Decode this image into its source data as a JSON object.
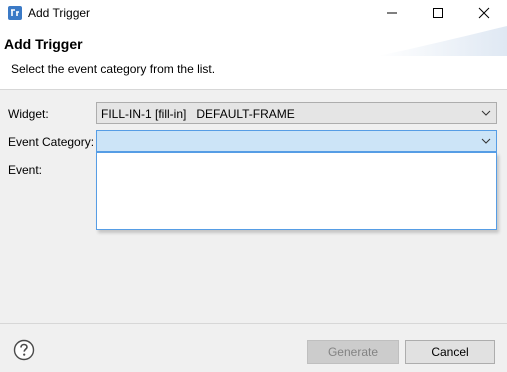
{
  "window": {
    "title": "Add Trigger"
  },
  "header": {
    "title": "Add Trigger",
    "message": "Select the event category from the list."
  },
  "form": {
    "widget": {
      "label": "Widget:",
      "value": "FILL-IN-1 [fill-in]   DEFAULT-FRAME"
    },
    "event_category": {
      "label": "Event Category:",
      "value": ""
    },
    "event": {
      "label": "Event:"
    }
  },
  "footer": {
    "generate_label": "Generate",
    "cancel_label": "Cancel"
  },
  "icons": {
    "app": "app-icon",
    "minimize": "minimize-icon",
    "maximize": "maximize-icon",
    "close": "close-icon",
    "dropdown": "chevron-down-icon",
    "help": "help-icon"
  },
  "colors": {
    "focus_fill": "#cce4f7",
    "focus_border": "#569de5",
    "disabled_text": "#838383"
  }
}
